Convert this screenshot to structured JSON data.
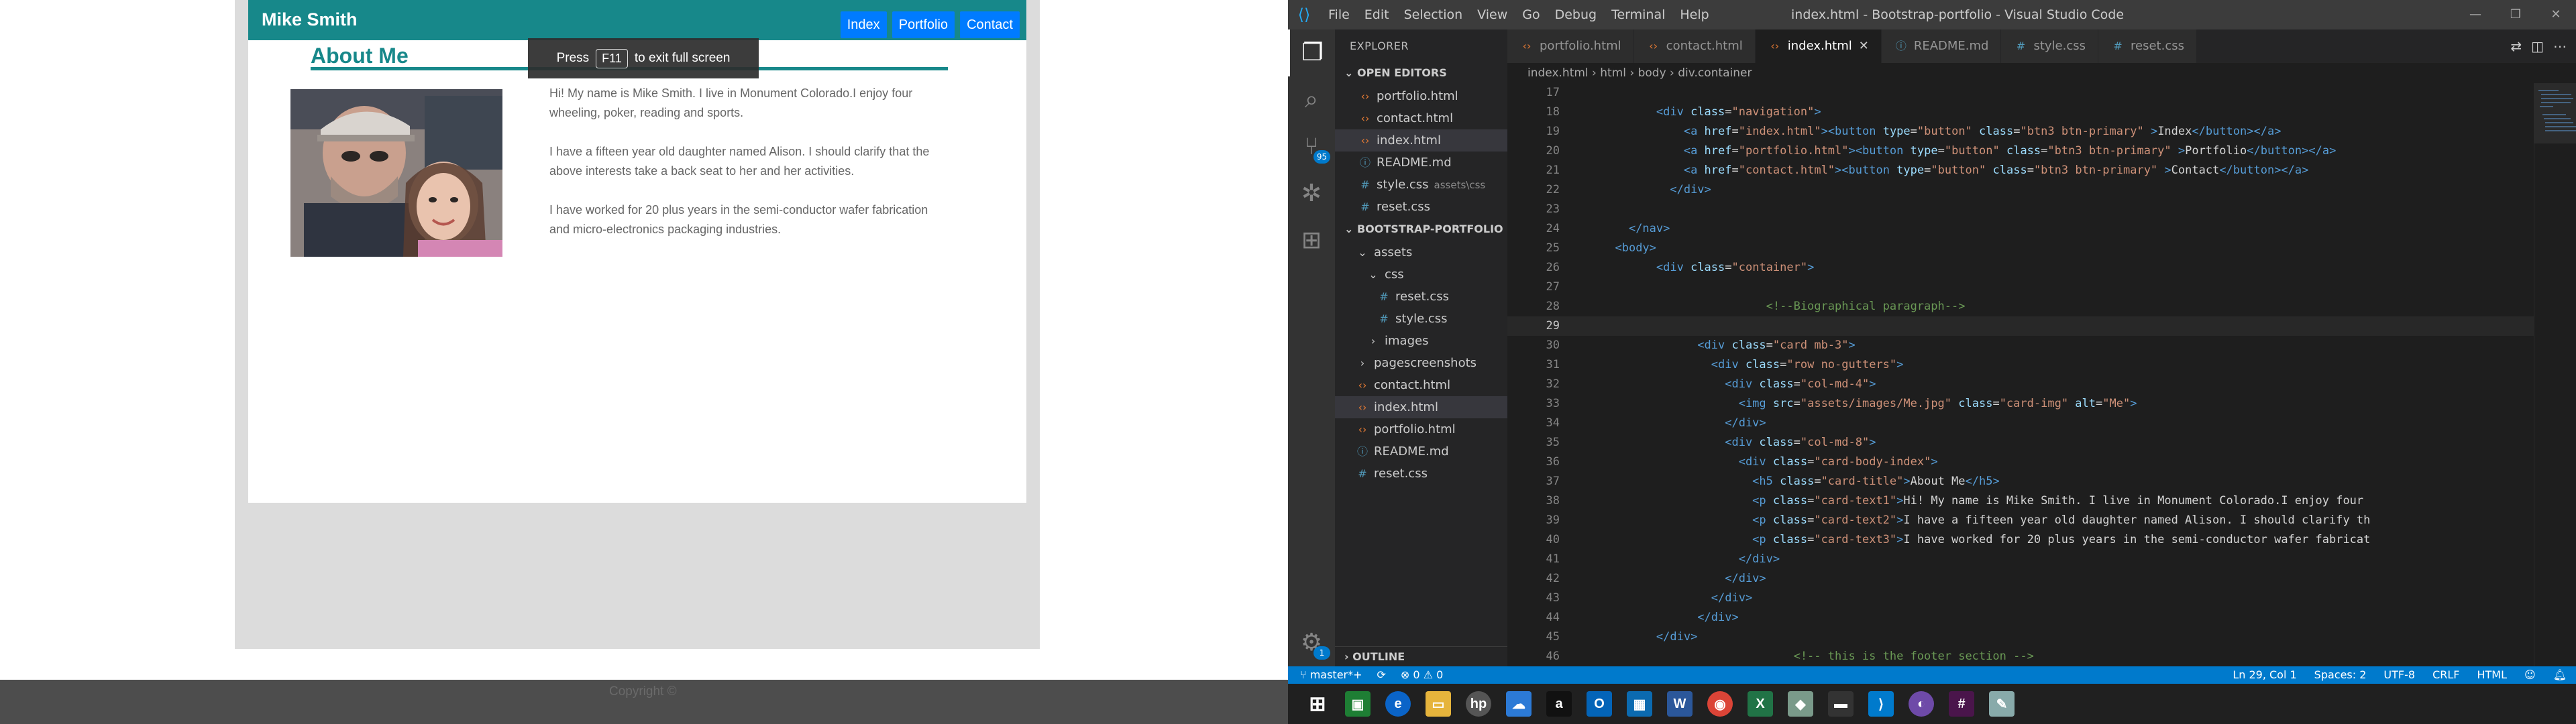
{
  "browser_page": {
    "site_name": "Mike Smith",
    "nav": [
      "Index",
      "Portfolio",
      "Contact"
    ],
    "about_title": "About Me",
    "photo_alt": "Me",
    "bio": [
      "Hi! My name is Mike Smith. I live in Monument Colorado.I enjoy four wheeling, poker, reading and sports.",
      "I have a fifteen year old daughter named Alison. I should clarify that the above interests take a back seat to her and her activities.",
      "I have worked for 20 plus years in the semi-conductor wafer fabrication and micro-electronics packaging industries."
    ],
    "fullscreen_hint": {
      "prefix": "Press",
      "key": "F11",
      "suffix": "to exit full screen"
    },
    "footer_text": "Copyright ©"
  },
  "vscode": {
    "menu": [
      "File",
      "Edit",
      "Selection",
      "View",
      "Go",
      "Debug",
      "Terminal",
      "Help"
    ],
    "window_title": "index.html - Bootstrap-portfolio - Visual Studio Code",
    "explorer_title": "EXPLORER",
    "open_editors_header": "OPEN EDITORS",
    "open_editors": [
      {
        "name": "portfolio.html",
        "type": "html",
        "detail": ""
      },
      {
        "name": "contact.html",
        "type": "html",
        "detail": ""
      },
      {
        "name": "index.html",
        "type": "html",
        "detail": ""
      },
      {
        "name": "README.md",
        "type": "md",
        "detail": ""
      },
      {
        "name": "style.css",
        "type": "css",
        "detail": "assets\\css"
      },
      {
        "name": "reset.css",
        "type": "css",
        "detail": ""
      }
    ],
    "project_header": "BOOTSTRAP-PORTFOLIO",
    "project_tree": [
      {
        "name": "assets",
        "type": "folder",
        "level": 1,
        "arrow": "⌄"
      },
      {
        "name": "css",
        "type": "folder",
        "level": 2,
        "arrow": "⌄"
      },
      {
        "name": "reset.css",
        "type": "css",
        "level": 3,
        "arrow": ""
      },
      {
        "name": "style.css",
        "type": "css",
        "level": 3,
        "arrow": ""
      },
      {
        "name": "images",
        "type": "folder",
        "level": 2,
        "arrow": "›"
      },
      {
        "name": "pagescreenshots",
        "type": "folder",
        "level": 1,
        "arrow": "›"
      },
      {
        "name": "contact.html",
        "type": "html",
        "level": 1,
        "arrow": ""
      },
      {
        "name": "index.html",
        "type": "html",
        "level": 1,
        "arrow": ""
      },
      {
        "name": "portfolio.html",
        "type": "html",
        "level": 1,
        "arrow": ""
      },
      {
        "name": "README.md",
        "type": "md",
        "level": 1,
        "arrow": ""
      },
      {
        "name": "reset.css",
        "type": "css",
        "level": 1,
        "arrow": ""
      }
    ],
    "outline_header": "OUTLINE",
    "source_control_badge": "95",
    "settings_badge": "1",
    "tabs": [
      {
        "label": "portfolio.html",
        "type": "html",
        "active": false
      },
      {
        "label": "contact.html",
        "type": "html",
        "active": false
      },
      {
        "label": "index.html",
        "type": "html",
        "active": true
      },
      {
        "label": "README.md",
        "type": "md",
        "active": false
      },
      {
        "label": "style.css",
        "type": "css",
        "active": false
      },
      {
        "label": "reset.css",
        "type": "css",
        "active": false
      }
    ],
    "breadcrumb": [
      "index.html",
      "html",
      "body",
      "div.container"
    ],
    "code_lines": [
      {
        "n": "17",
        "indent": 0,
        "parts": []
      },
      {
        "n": "18",
        "indent": 4,
        "parts": [
          [
            "t-tag",
            "<div "
          ],
          [
            "t-attr",
            "class"
          ],
          [
            "t-txt",
            "="
          ],
          [
            "t-str",
            "\"navigation\""
          ],
          [
            "t-tag",
            ">"
          ]
        ]
      },
      {
        "n": "19",
        "indent": 6,
        "parts": [
          [
            "t-tag",
            "<a "
          ],
          [
            "t-attr",
            "href"
          ],
          [
            "t-txt",
            "="
          ],
          [
            "t-str",
            "\"index.html\""
          ],
          [
            "t-tag",
            "><button "
          ],
          [
            "t-attr",
            "type"
          ],
          [
            "t-txt",
            "="
          ],
          [
            "t-str",
            "\"button\" "
          ],
          [
            "t-attr",
            "class"
          ],
          [
            "t-txt",
            "="
          ],
          [
            "t-str",
            "\"btn3 btn-primary\" "
          ],
          [
            "t-tag",
            ">"
          ],
          [
            "t-txt",
            "Index"
          ],
          [
            "t-tag",
            "</button></a>"
          ]
        ]
      },
      {
        "n": "20",
        "indent": 6,
        "parts": [
          [
            "t-tag",
            "<a "
          ],
          [
            "t-attr",
            "href"
          ],
          [
            "t-txt",
            "="
          ],
          [
            "t-str",
            "\"portfolio.html\""
          ],
          [
            "t-tag",
            "><button "
          ],
          [
            "t-attr",
            "type"
          ],
          [
            "t-txt",
            "="
          ],
          [
            "t-str",
            "\"button\" "
          ],
          [
            "t-attr",
            "class"
          ],
          [
            "t-txt",
            "="
          ],
          [
            "t-str",
            "\"btn3 btn-primary\" "
          ],
          [
            "t-tag",
            ">"
          ],
          [
            "t-txt",
            "Portfolio"
          ],
          [
            "t-tag",
            "</button></a>"
          ]
        ]
      },
      {
        "n": "21",
        "indent": 6,
        "parts": [
          [
            "t-tag",
            "<a "
          ],
          [
            "t-attr",
            "href"
          ],
          [
            "t-txt",
            "="
          ],
          [
            "t-str",
            "\"contact.html\""
          ],
          [
            "t-tag",
            "><button "
          ],
          [
            "t-attr",
            "type"
          ],
          [
            "t-txt",
            "="
          ],
          [
            "t-str",
            "\"button\" "
          ],
          [
            "t-attr",
            "class"
          ],
          [
            "t-txt",
            "="
          ],
          [
            "t-str",
            "\"btn3 btn-primary\" "
          ],
          [
            "t-tag",
            ">"
          ],
          [
            "t-txt",
            "Contact"
          ],
          [
            "t-tag",
            "</button></a>"
          ]
        ]
      },
      {
        "n": "22",
        "indent": 5,
        "parts": [
          [
            "t-tag",
            "</div>"
          ]
        ]
      },
      {
        "n": "23",
        "indent": 0,
        "parts": []
      },
      {
        "n": "24",
        "indent": 2,
        "parts": [
          [
            "t-tag",
            "</nav>"
          ]
        ]
      },
      {
        "n": "25",
        "indent": 1,
        "parts": [
          [
            "t-tag",
            "<body>"
          ]
        ]
      },
      {
        "n": "26",
        "indent": 4,
        "parts": [
          [
            "t-tag",
            "<div "
          ],
          [
            "t-attr",
            "class"
          ],
          [
            "t-txt",
            "="
          ],
          [
            "t-str",
            "\"container\""
          ],
          [
            "t-tag",
            ">"
          ]
        ]
      },
      {
        "n": "27",
        "indent": 0,
        "parts": []
      },
      {
        "n": "28",
        "indent": 12,
        "parts": [
          [
            "t-com",
            "<!--Biographical paragraph-->"
          ]
        ]
      },
      {
        "n": "29",
        "indent": 0,
        "parts": []
      },
      {
        "n": "30",
        "indent": 7,
        "parts": [
          [
            "t-tag",
            "<div "
          ],
          [
            "t-attr",
            "class"
          ],
          [
            "t-txt",
            "="
          ],
          [
            "t-str",
            "\"card mb-3\""
          ],
          [
            "t-tag",
            ">"
          ]
        ]
      },
      {
        "n": "31",
        "indent": 8,
        "parts": [
          [
            "t-tag",
            "<div "
          ],
          [
            "t-attr",
            "class"
          ],
          [
            "t-txt",
            "="
          ],
          [
            "t-str",
            "\"row no-gutters\""
          ],
          [
            "t-tag",
            ">"
          ]
        ]
      },
      {
        "n": "32",
        "indent": 9,
        "parts": [
          [
            "t-tag",
            "<div "
          ],
          [
            "t-attr",
            "class"
          ],
          [
            "t-txt",
            "="
          ],
          [
            "t-str",
            "\"col-md-4\""
          ],
          [
            "t-tag",
            ">"
          ]
        ]
      },
      {
        "n": "33",
        "indent": 10,
        "parts": [
          [
            "t-tag",
            "<img "
          ],
          [
            "t-attr",
            "src"
          ],
          [
            "t-txt",
            "="
          ],
          [
            "t-str",
            "\"assets/images/Me.jpg\" "
          ],
          [
            "t-attr",
            "class"
          ],
          [
            "t-txt",
            "="
          ],
          [
            "t-str",
            "\"card-img\" "
          ],
          [
            "t-attr",
            "alt"
          ],
          [
            "t-txt",
            "="
          ],
          [
            "t-str",
            "\"Me\""
          ],
          [
            "t-tag",
            ">"
          ]
        ]
      },
      {
        "n": "34",
        "indent": 9,
        "parts": [
          [
            "t-tag",
            "</div>"
          ]
        ]
      },
      {
        "n": "35",
        "indent": 9,
        "parts": [
          [
            "t-tag",
            "<div "
          ],
          [
            "t-attr",
            "class"
          ],
          [
            "t-txt",
            "="
          ],
          [
            "t-str",
            "\"col-md-8\""
          ],
          [
            "t-tag",
            ">"
          ]
        ]
      },
      {
        "n": "36",
        "indent": 10,
        "parts": [
          [
            "t-tag",
            "<div "
          ],
          [
            "t-attr",
            "class"
          ],
          [
            "t-txt",
            "="
          ],
          [
            "t-str",
            "\"card-body-index\""
          ],
          [
            "t-tag",
            ">"
          ]
        ]
      },
      {
        "n": "37",
        "indent": 11,
        "parts": [
          [
            "t-tag",
            "<h5 "
          ],
          [
            "t-attr",
            "class"
          ],
          [
            "t-txt",
            "="
          ],
          [
            "t-str",
            "\"card-title\""
          ],
          [
            "t-tag",
            ">"
          ],
          [
            "t-txt",
            "About Me"
          ],
          [
            "t-tag",
            "</h5>"
          ]
        ]
      },
      {
        "n": "38",
        "indent": 11,
        "parts": [
          [
            "t-tag",
            "<p "
          ],
          [
            "t-attr",
            "class"
          ],
          [
            "t-txt",
            "="
          ],
          [
            "t-str",
            "\"card-text1\""
          ],
          [
            "t-tag",
            ">"
          ],
          [
            "t-txt",
            "Hi! My name is Mike Smith. I live in Monument Colorado.I enjoy four"
          ]
        ]
      },
      {
        "n": "39",
        "indent": 11,
        "parts": [
          [
            "t-tag",
            "<p "
          ],
          [
            "t-attr",
            "class"
          ],
          [
            "t-txt",
            "="
          ],
          [
            "t-str",
            "\"card-text2\""
          ],
          [
            "t-tag",
            ">"
          ],
          [
            "t-txt",
            "I have a fifteen year old daughter named Alison. I should clarify th"
          ]
        ]
      },
      {
        "n": "40",
        "indent": 11,
        "parts": [
          [
            "t-tag",
            "<p "
          ],
          [
            "t-attr",
            "class"
          ],
          [
            "t-txt",
            "="
          ],
          [
            "t-str",
            "\"card-text3\""
          ],
          [
            "t-tag",
            ">"
          ],
          [
            "t-txt",
            "I have worked for 20 plus years in the semi-conductor wafer fabricat"
          ]
        ]
      },
      {
        "n": "41",
        "indent": 10,
        "parts": [
          [
            "t-tag",
            "</div>"
          ]
        ]
      },
      {
        "n": "42",
        "indent": 9,
        "parts": [
          [
            "t-tag",
            "</div>"
          ]
        ]
      },
      {
        "n": "43",
        "indent": 8,
        "parts": [
          [
            "t-tag",
            "</div>"
          ]
        ]
      },
      {
        "n": "44",
        "indent": 7,
        "parts": [
          [
            "t-tag",
            "</div>"
          ]
        ]
      },
      {
        "n": "45",
        "indent": 4,
        "parts": [
          [
            "t-tag",
            "</div>"
          ]
        ]
      },
      {
        "n": "46",
        "indent": 14,
        "parts": [
          [
            "t-com",
            "<!-- this is the footer section -->"
          ]
        ]
      }
    ],
    "current_line": "29",
    "status": {
      "branch": "master*+",
      "errors": "0",
      "warnings": "0",
      "position": "Ln 29, Col 1",
      "spaces": "Spaces: 2",
      "encoding": "UTF-8",
      "eol": "CRLF",
      "language": "HTML"
    }
  },
  "taskbar": {
    "items": [
      "start",
      "store",
      "edge",
      "file-explorer",
      "hp",
      "onedrive",
      "amazon",
      "outlook",
      "photos",
      "word",
      "chrome",
      "excel",
      "app",
      "terminal",
      "vscode",
      "github",
      "slack",
      "paint"
    ]
  },
  "colors": {
    "accent_teal": "#17888a",
    "nav_blue": "#007bff",
    "vscode_blue": "#007acc"
  }
}
